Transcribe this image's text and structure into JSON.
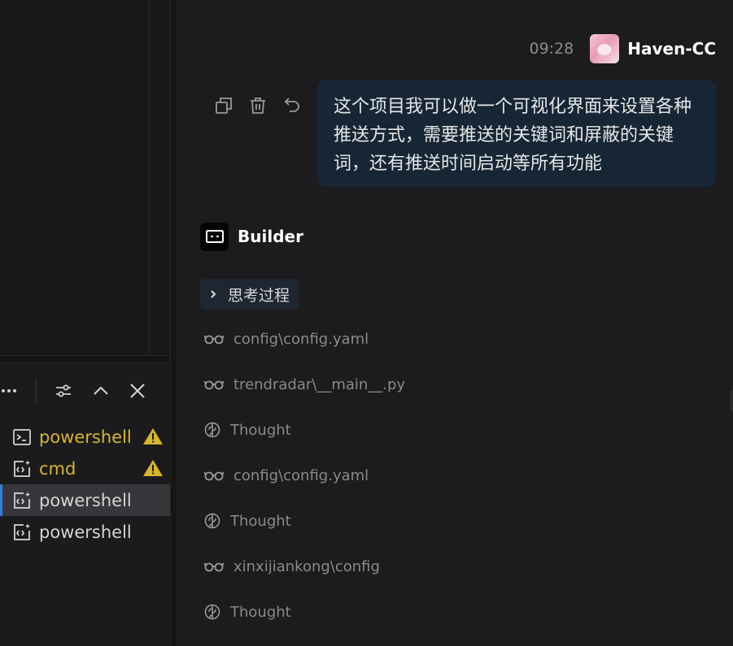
{
  "terminal_panel": {
    "toolbar": {
      "more_icon": "ellipsis-icon",
      "settings_icon": "sliders-icon",
      "collapse_icon": "chevron-up-icon",
      "close_icon": "close-icon"
    },
    "terminals": [
      {
        "label": "powershell",
        "icon": "terminal-icon",
        "warning": true,
        "active": false
      },
      {
        "label": "cmd",
        "icon": "terminal-sparkle-icon",
        "warning": true,
        "active": false
      },
      {
        "label": "powershell",
        "icon": "terminal-sparkle-icon",
        "warning": false,
        "active": true
      },
      {
        "label": "powershell",
        "icon": "terminal-sparkle-icon",
        "warning": false,
        "active": false
      }
    ],
    "colors": {
      "warning": "#d7b52c",
      "active_accent": "#2f7fe0"
    }
  },
  "chat": {
    "user_message": {
      "time": "09:28",
      "user_name": "Haven-CC",
      "text": "这个项目我可以做一个可视化界面来设置各种推送方式，需要推送的关键词和屏蔽的关键词，还有推送时间启动等所有功能",
      "actions": [
        "copy-icon",
        "trash-icon",
        "undo-icon"
      ]
    },
    "assistant": {
      "name": "Builder",
      "thinking_label": "思考过程",
      "steps": [
        {
          "type": "read",
          "icon": "glasses-icon",
          "text": "config\\config.yaml"
        },
        {
          "type": "read",
          "icon": "glasses-icon",
          "text": "trendradar\\__main__.py"
        },
        {
          "type": "thought",
          "icon": "brain-icon",
          "text": "Thought"
        },
        {
          "type": "read",
          "icon": "glasses-icon",
          "text": "config\\config.yaml"
        },
        {
          "type": "thought",
          "icon": "brain-icon",
          "text": "Thought"
        },
        {
          "type": "read",
          "icon": "glasses-icon",
          "text": "xinxijiankong\\config"
        },
        {
          "type": "thought",
          "icon": "brain-icon",
          "text": "Thought"
        }
      ]
    },
    "colors": {
      "bubble_bg": "#162635",
      "background": "#1c1c1e"
    }
  }
}
